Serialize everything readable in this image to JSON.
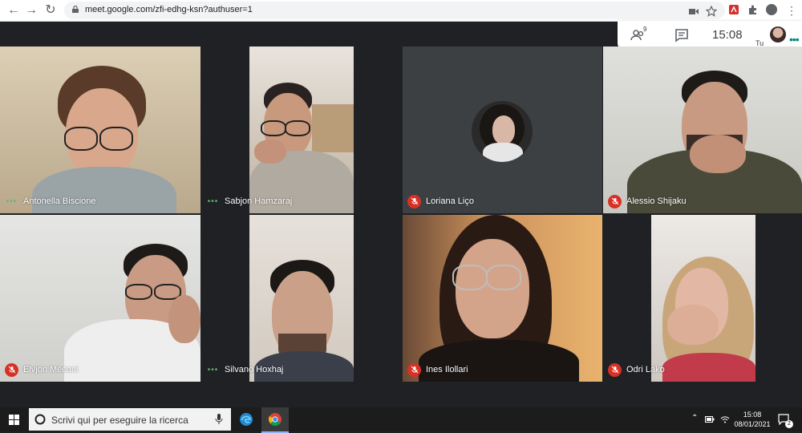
{
  "browser": {
    "url": "meet.google.com/zfi-edhg-ksn?authuser=1"
  },
  "meet": {
    "participants_badge": "9",
    "time": "15:08",
    "self_label": "Tu"
  },
  "participants": [
    {
      "name": "Antonella Biscione",
      "mic": "active"
    },
    {
      "name": "Sabjon Hamzaraj",
      "mic": "active"
    },
    {
      "name": "Loriana Liço",
      "mic": "muted"
    },
    {
      "name": "Alessio Shijaku",
      "mic": "muted"
    },
    {
      "name": "Elvjon Mecani",
      "mic": "muted"
    },
    {
      "name": "Silvano Hoxhaj",
      "mic": "active"
    },
    {
      "name": "Ines Ilollari",
      "mic": "muted"
    },
    {
      "name": "Odri Lako",
      "mic": "muted"
    }
  ],
  "taskbar": {
    "search_placeholder": "Scrivi qui per eseguire la ricerca",
    "time": "15:08",
    "date": "08/01/2021",
    "notification_count": "2"
  },
  "colors": {
    "meet_background": "#202124",
    "muted_red": "#d93025",
    "speaking_green": "#5bb974"
  }
}
